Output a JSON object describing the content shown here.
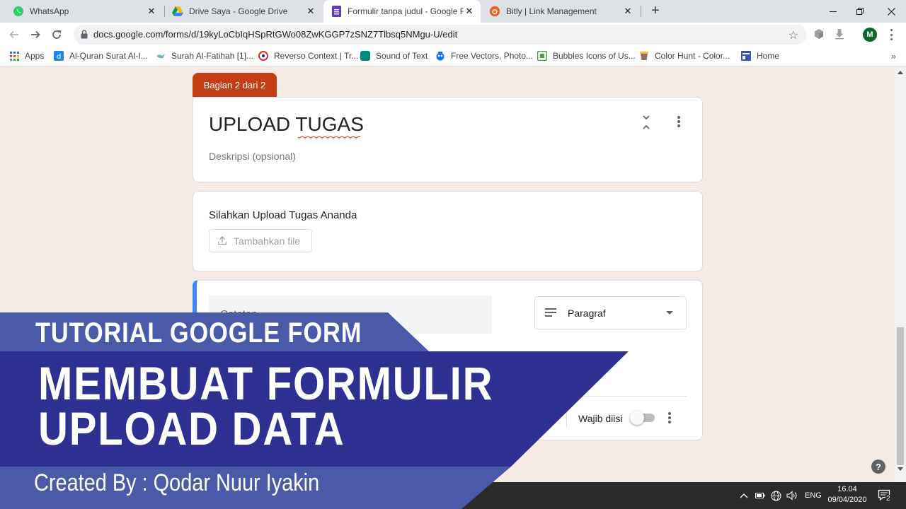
{
  "browser": {
    "tabs": [
      {
        "title": "WhatsApp",
        "icon": "whatsapp-icon"
      },
      {
        "title": "Drive Saya - Google Drive",
        "icon": "google-drive-icon"
      },
      {
        "title": "Formulir tanpa judul - Google Fo",
        "icon": "google-forms-icon",
        "active": true
      },
      {
        "title": "Bitly | Link Management",
        "icon": "bitly-icon"
      }
    ],
    "url": "docs.google.com/forms/d/19kyLoCbIqHSpRtGWo08ZwKGGP7zSNZ7Tlbsq5NMgu-U/edit",
    "profile_initial": "M",
    "bookmarks": [
      {
        "label": "Apps",
        "icon": "apps-grid-icon"
      },
      {
        "label": "Al-Quran Surat Al-I...",
        "icon": "quran-icon"
      },
      {
        "label": "Surah Al-Fatihah [1]...",
        "icon": "bird-icon"
      },
      {
        "label": "Reverso Context | Tr...",
        "icon": "reverso-icon"
      },
      {
        "label": "Sound of Text",
        "icon": "sound-of-text-icon"
      },
      {
        "label": "Free Vectors, Photo...",
        "icon": "freepik-icon"
      },
      {
        "label": "Bubbles Icons of Us...",
        "icon": "bubbles-icon"
      },
      {
        "label": "Color Hunt - Color...",
        "icon": "color-hunt-icon"
      },
      {
        "label": "Home",
        "icon": "home-page-icon"
      }
    ]
  },
  "form": {
    "section_badge": "Bagian 2 dari 2",
    "title": "UPLOAD TUGAS",
    "description_placeholder": "Deskripsi (opsional)",
    "upload_question": "Silahkan Upload Tugas Ananda",
    "upload_button": "Tambahkan file",
    "question_placeholder": "Catatan",
    "question_type": "Paragraf",
    "required_label": "Wajib diisi",
    "required_on": false,
    "help": "?"
  },
  "taskbar": {
    "language": "ENG",
    "time": "16.04",
    "date": "09/04/2020",
    "notifications": "2"
  },
  "overlay": {
    "kicker": "TUTORIAL GOOGLE FORM",
    "headline_line1": "MEMBUAT FORMULIR",
    "headline_line2": "UPLOAD DATA",
    "credit": "Created By : Qodar Nuur Iyakin"
  },
  "colors": {
    "form_accent": "#c53d13",
    "focus_bar": "#4285f4",
    "banner_dark": "#2e3192",
    "banner_light": "#4a5aa8"
  }
}
